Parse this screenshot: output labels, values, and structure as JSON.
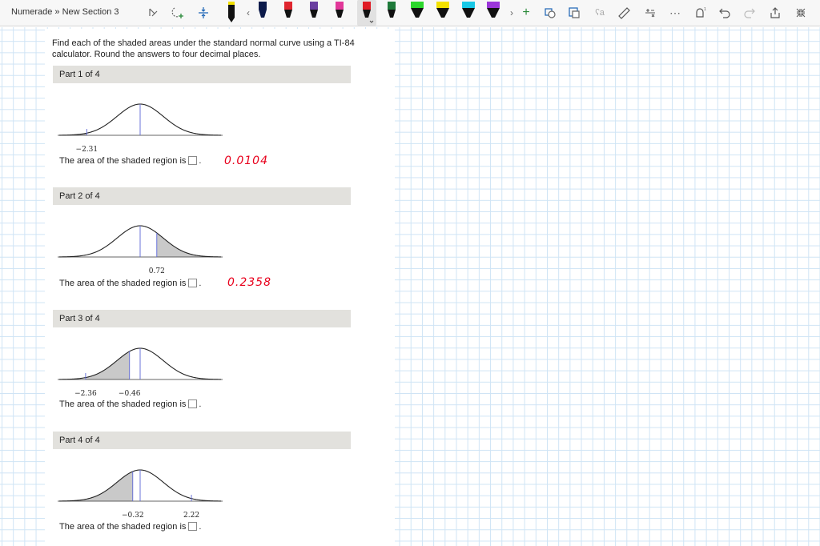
{
  "toolbar": {
    "breadcrumb": "Numerade » New Section 3",
    "icons": [
      "lasso-select-icon",
      "add-space-icon",
      "insert-space-icon",
      "pen-black",
      "chevron-left",
      "pen-navy",
      "pen-red",
      "pen-purple",
      "pen-pink",
      "pen-red-selected",
      "pen-green",
      "pen-lightgreen",
      "pen-yellow",
      "pen-cyan",
      "pen-purple2",
      "chevron-right",
      "add-pen-icon",
      "ink-to-shape-icon",
      "ink-to-text-icon",
      "ink-to-math-icon",
      "ruler-icon",
      "math-icon",
      "more-icon",
      "replay-icon",
      "undo-icon",
      "redo-icon",
      "share-icon",
      "collapse-icon"
    ],
    "colors": {
      "pen_black": "#111111",
      "pen_navy": "#0c1a4a",
      "pen_red": "#e0262f",
      "pen_purple": "#6a3ea1",
      "pen_pink": "#e2389a",
      "pen_red_selected": "#e01b24",
      "pen_green": "#1f7a3a",
      "pen_lightgreen": "#2bd62b",
      "pen_yellow": "#f2e000",
      "pen_cyan": "#19c8e6",
      "pen_purple2": "#9b36d9"
    }
  },
  "problem": {
    "instructions": "Find each of the shaded areas under the standard normal curve using a TI-84 calculator. Round the answers to four decimal places.",
    "parts": [
      {
        "header": "Part 1 of 4",
        "ticks": [
          "-2.31"
        ],
        "answer_text": "The area of the shaded region is",
        "handwritten": "0.0104"
      },
      {
        "header": "Part 2 of 4",
        "ticks": [
          "0.72"
        ],
        "answer_text": "The area of the shaded region is",
        "handwritten": "0.2358"
      },
      {
        "header": "Part 3 of 4",
        "ticks": [
          "-2.36",
          "-0.46"
        ],
        "answer_text": "The area of the shaded region is",
        "handwritten": ""
      },
      {
        "header": "Part 4 of 4",
        "ticks": [
          "-0.32",
          "2.22"
        ],
        "answer_text": "The area of the shaded region is",
        "handwritten": ""
      }
    ]
  },
  "chart_data": [
    {
      "type": "area",
      "curve": "standard-normal",
      "shaded": {
        "from": null,
        "to": -2.31
      },
      "ticks": [
        -2.31
      ],
      "xlim": [
        -3.5,
        3.5
      ]
    },
    {
      "type": "area",
      "curve": "standard-normal",
      "shaded": {
        "from": 0.72,
        "to": null
      },
      "ticks": [
        0.72
      ],
      "xlim": [
        -3.5,
        3.5
      ]
    },
    {
      "type": "area",
      "curve": "standard-normal",
      "shaded": {
        "from": -2.36,
        "to": -0.46
      },
      "ticks": [
        -2.36,
        -0.46
      ],
      "xlim": [
        -3.5,
        3.5
      ]
    },
    {
      "type": "area",
      "curve": "standard-normal",
      "shaded": {
        "from": null,
        "to": -0.32
      },
      "ticks": [
        -0.32,
        2.22
      ],
      "xlim": [
        -3.5,
        3.5
      ]
    }
  ]
}
